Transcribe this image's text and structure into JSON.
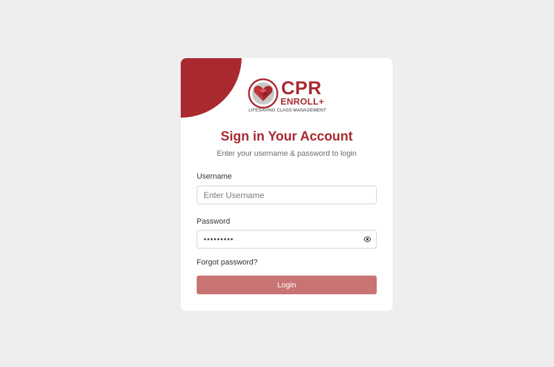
{
  "logo": {
    "icon": "heart-cube-logo-icon",
    "cpr": "CPR",
    "enroll": "ENROLL",
    "plus": "+",
    "tagline": "LIFESAVING CLASS MANAGEMENT"
  },
  "title": "Sign in Your Account",
  "subtitle": "Enter your username & password to login",
  "username": {
    "label": "Username",
    "placeholder": "Enter Username",
    "value": ""
  },
  "password": {
    "label": "Password",
    "value": "•••••••••",
    "toggle_icon": "eye-icon"
  },
  "forgot_password": "Forgot password?",
  "login_button": "Login",
  "colors": {
    "brand": "#a82a2f",
    "button": "#c97474",
    "background": "#eeeeee"
  }
}
